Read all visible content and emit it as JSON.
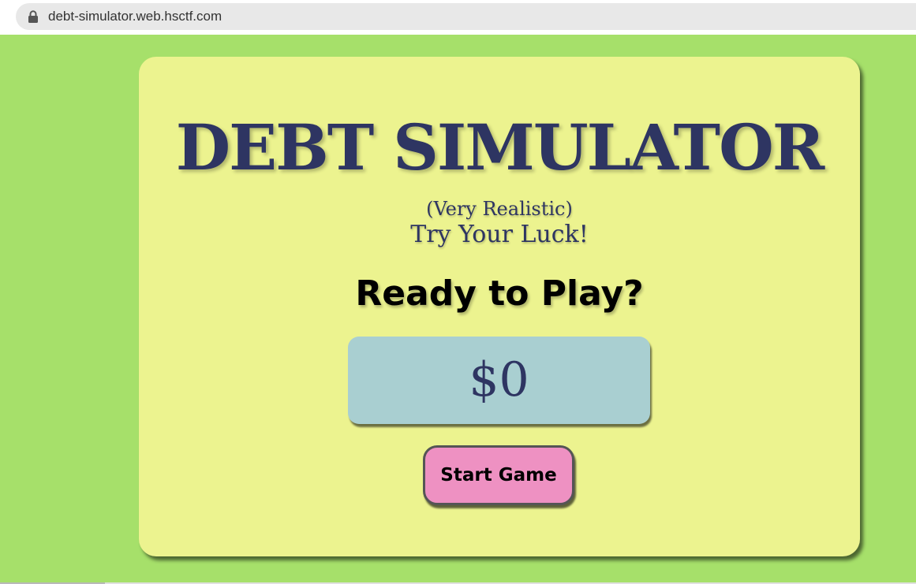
{
  "browser": {
    "url": "debt-simulator.web.hsctf.com",
    "lock_icon": "lock-icon"
  },
  "game": {
    "title": "DEBT SIMULATOR",
    "subtitle": "(Very Realistic)",
    "tagline": "Try Your Luck!",
    "prompt": "Ready to Play?",
    "balance": "$0",
    "start_button_label": "Start Game"
  },
  "colors": {
    "page_background": "#a6e06a",
    "card_background": "#ecf38f",
    "title_text": "#2e3562",
    "balance_box": "#a9cfd1",
    "start_button": "#ee91c2"
  }
}
